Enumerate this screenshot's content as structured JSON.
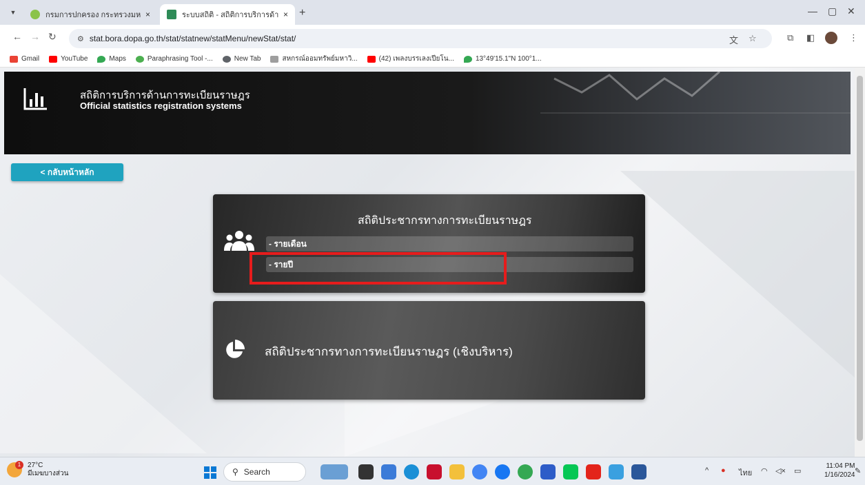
{
  "browser": {
    "tabs": [
      {
        "title": "กรมการปกครอง กระทรวงมหาดไทย",
        "active": false
      },
      {
        "title": "ระบบสถิติ - สถิติการบริการด้านการ",
        "active": true
      }
    ],
    "new_tab_symbol": "+",
    "close_symbol": "×",
    "url": "stat.bora.dopa.go.th/stat/statnew/statMenu/newStat/stat/",
    "bookmarks": [
      {
        "label": "Gmail",
        "icon": "gmail-icon",
        "color": "#ea4335"
      },
      {
        "label": "YouTube",
        "icon": "youtube-icon",
        "color": "#ff0000"
      },
      {
        "label": "Maps",
        "icon": "maps-icon",
        "color": "#34a853"
      },
      {
        "label": "Paraphrasing Tool -...",
        "icon": "quillbot-icon",
        "color": "#4caf50"
      },
      {
        "label": "New Tab",
        "icon": "chrome-icon",
        "color": "#5f6368"
      },
      {
        "label": "สหกรณ์ออมทรัพย์มหาวิ...",
        "icon": "coop-icon",
        "color": "#9e9e9e"
      },
      {
        "label": "(42) เพลงบรรเลงเปียโน...",
        "icon": "youtube-icon",
        "color": "#ff0000"
      },
      {
        "label": "13°49'15.1\"N 100°1...",
        "icon": "maps-icon",
        "color": "#34a853"
      }
    ]
  },
  "header": {
    "title_th": "สถิติการบริการด้านการทะเบียนราษฎร",
    "title_en": "Official statistics registration systems"
  },
  "back_button": "< กลับหน้าหลัก",
  "cards": {
    "population": {
      "title": "สถิติประชากรทางการทะเบียนราษฎร",
      "items": [
        "- รายเดือน",
        "- รายปี"
      ]
    },
    "executive": {
      "title": "สถิติประชากรทางการทะเบียนราษฎร (เชิงบริหาร)"
    }
  },
  "taskbar": {
    "weather_temp": "27°C",
    "weather_desc": "มีเมฆบางส่วน",
    "weather_badge": "1",
    "search_label": "Search",
    "lang": "ไทย",
    "time": "11:04 PM",
    "date": "1/16/2024",
    "apps": [
      {
        "name": "character-icon",
        "color": "#6a9fd4"
      },
      {
        "name": "task-view-icon",
        "color": "#333333"
      },
      {
        "name": "copilot-icon",
        "color": "#3b7bd8"
      },
      {
        "name": "edge-icon",
        "color": "#1a8fd6"
      },
      {
        "name": "mcafee-icon",
        "color": "#c8102e"
      },
      {
        "name": "file-explorer-icon",
        "color": "#f3c03b"
      },
      {
        "name": "chrome-icon",
        "color": "#4285f4"
      },
      {
        "name": "facebook-icon",
        "color": "#1877f2"
      },
      {
        "name": "chrome-alt-icon",
        "color": "#34a853"
      },
      {
        "name": "zoom-icon",
        "color": "#2d5cc8"
      },
      {
        "name": "line-icon",
        "color": "#06c755"
      },
      {
        "name": "acrobat-icon",
        "color": "#e3241b"
      },
      {
        "name": "snipping-icon",
        "color": "#3aa0e0"
      },
      {
        "name": "word-icon",
        "color": "#2b579a"
      }
    ]
  }
}
